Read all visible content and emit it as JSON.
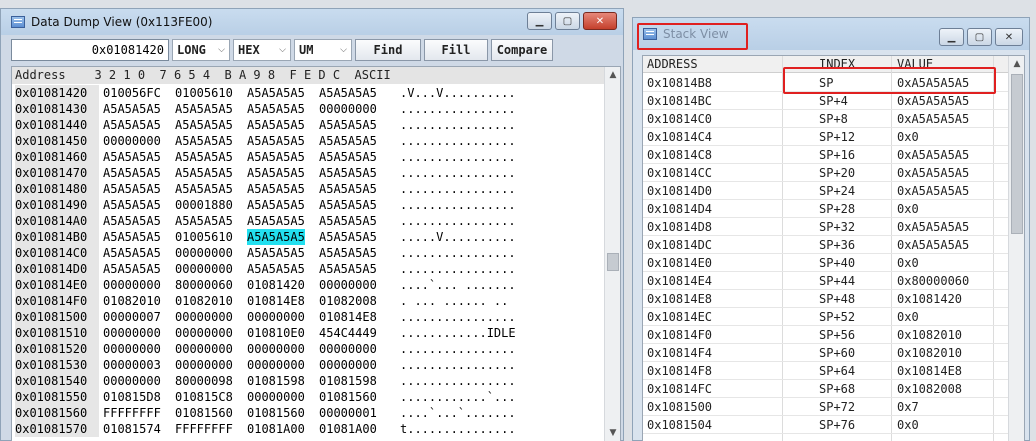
{
  "dump_window": {
    "title": "Data Dump View (0x113FE00)",
    "address_input": "0x01081420",
    "selects": [
      "LONG",
      "HEX",
      "UM"
    ],
    "buttons": [
      "Find",
      "Fill",
      "Compare"
    ],
    "header": "Address    3 2 1 0  7 6 5 4  B A 9 8  F E D C  ASCII",
    "highlight": {
      "row": 9,
      "col": 2
    },
    "rows": [
      {
        "addr": "0x01081420",
        "w": [
          "010056FC",
          "01005610",
          "A5A5A5A5",
          "A5A5A5A5"
        ],
        "ascii": ".V...V.........."
      },
      {
        "addr": "0x01081430",
        "w": [
          "A5A5A5A5",
          "A5A5A5A5",
          "A5A5A5A5",
          "00000000"
        ],
        "ascii": "................"
      },
      {
        "addr": "0x01081440",
        "w": [
          "A5A5A5A5",
          "A5A5A5A5",
          "A5A5A5A5",
          "A5A5A5A5"
        ],
        "ascii": "................"
      },
      {
        "addr": "0x01081450",
        "w": [
          "00000000",
          "A5A5A5A5",
          "A5A5A5A5",
          "A5A5A5A5"
        ],
        "ascii": "................"
      },
      {
        "addr": "0x01081460",
        "w": [
          "A5A5A5A5",
          "A5A5A5A5",
          "A5A5A5A5",
          "A5A5A5A5"
        ],
        "ascii": "................"
      },
      {
        "addr": "0x01081470",
        "w": [
          "A5A5A5A5",
          "A5A5A5A5",
          "A5A5A5A5",
          "A5A5A5A5"
        ],
        "ascii": "................"
      },
      {
        "addr": "0x01081480",
        "w": [
          "A5A5A5A5",
          "A5A5A5A5",
          "A5A5A5A5",
          "A5A5A5A5"
        ],
        "ascii": "................"
      },
      {
        "addr": "0x01081490",
        "w": [
          "A5A5A5A5",
          "00001880",
          "A5A5A5A5",
          "A5A5A5A5"
        ],
        "ascii": "................"
      },
      {
        "addr": "0x010814A0",
        "w": [
          "A5A5A5A5",
          "A5A5A5A5",
          "A5A5A5A5",
          "A5A5A5A5"
        ],
        "ascii": "................"
      },
      {
        "addr": "0x010814B0",
        "w": [
          "A5A5A5A5",
          "01005610",
          "A5A5A5A5",
          "A5A5A5A5"
        ],
        "ascii": ".....V.........."
      },
      {
        "addr": "0x010814C0",
        "w": [
          "A5A5A5A5",
          "00000000",
          "A5A5A5A5",
          "A5A5A5A5"
        ],
        "ascii": "................"
      },
      {
        "addr": "0x010814D0",
        "w": [
          "A5A5A5A5",
          "00000000",
          "A5A5A5A5",
          "A5A5A5A5"
        ],
        "ascii": "................"
      },
      {
        "addr": "0x010814E0",
        "w": [
          "00000000",
          "80000060",
          "01081420",
          "00000000"
        ],
        "ascii": "....`... ......."
      },
      {
        "addr": "0x010814F0",
        "w": [
          "01082010",
          "01082010",
          "010814E8",
          "01082008"
        ],
        "ascii": ". ... ...... .."
      },
      {
        "addr": "0x01081500",
        "w": [
          "00000007",
          "00000000",
          "00000000",
          "010814E8"
        ],
        "ascii": "................"
      },
      {
        "addr": "0x01081510",
        "w": [
          "00000000",
          "00000000",
          "010810E0",
          "454C4449"
        ],
        "ascii": "............IDLE"
      },
      {
        "addr": "0x01081520",
        "w": [
          "00000000",
          "00000000",
          "00000000",
          "00000000"
        ],
        "ascii": "................"
      },
      {
        "addr": "0x01081530",
        "w": [
          "00000003",
          "00000000",
          "00000000",
          "00000000"
        ],
        "ascii": "................"
      },
      {
        "addr": "0x01081540",
        "w": [
          "00000000",
          "80000098",
          "01081598",
          "01081598"
        ],
        "ascii": "................"
      },
      {
        "addr": "0x01081550",
        "w": [
          "010815D8",
          "010815C8",
          "00000000",
          "01081560"
        ],
        "ascii": "............`..."
      },
      {
        "addr": "0x01081560",
        "w": [
          "FFFFFFFF",
          "01081560",
          "01081560",
          "00000001"
        ],
        "ascii": "....`...`......."
      },
      {
        "addr": "0x01081570",
        "w": [
          "01081574",
          "FFFFFFFF",
          "01081A00",
          "01081A00"
        ],
        "ascii": "t..............."
      }
    ]
  },
  "stack_window": {
    "title": "Stack View",
    "columns": [
      "ADDRESS",
      "INDEX",
      "VALUE"
    ],
    "highlight_row": 0,
    "rows": [
      {
        "address": "0x10814B8",
        "index": "SP",
        "value": "0xA5A5A5A5"
      },
      {
        "address": "0x10814BC",
        "index": "SP+4",
        "value": "0xA5A5A5A5"
      },
      {
        "address": "0x10814C0",
        "index": "SP+8",
        "value": "0xA5A5A5A5"
      },
      {
        "address": "0x10814C4",
        "index": "SP+12",
        "value": "0x0"
      },
      {
        "address": "0x10814C8",
        "index": "SP+16",
        "value": "0xA5A5A5A5"
      },
      {
        "address": "0x10814CC",
        "index": "SP+20",
        "value": "0xA5A5A5A5"
      },
      {
        "address": "0x10814D0",
        "index": "SP+24",
        "value": "0xA5A5A5A5"
      },
      {
        "address": "0x10814D4",
        "index": "SP+28",
        "value": "0x0"
      },
      {
        "address": "0x10814D8",
        "index": "SP+32",
        "value": "0xA5A5A5A5"
      },
      {
        "address": "0x10814DC",
        "index": "SP+36",
        "value": "0xA5A5A5A5"
      },
      {
        "address": "0x10814E0",
        "index": "SP+40",
        "value": "0x0"
      },
      {
        "address": "0x10814E4",
        "index": "SP+44",
        "value": "0x80000060"
      },
      {
        "address": "0x10814E8",
        "index": "SP+48",
        "value": "0x1081420"
      },
      {
        "address": "0x10814EC",
        "index": "SP+52",
        "value": "0x0"
      },
      {
        "address": "0x10814F0",
        "index": "SP+56",
        "value": "0x1082010"
      },
      {
        "address": "0x10814F4",
        "index": "SP+60",
        "value": "0x1082010"
      },
      {
        "address": "0x10814F8",
        "index": "SP+64",
        "value": "0x10814E8"
      },
      {
        "address": "0x10814FC",
        "index": "SP+68",
        "value": "0x1082008"
      },
      {
        "address": "0x1081500",
        "index": "SP+72",
        "value": "0x7"
      },
      {
        "address": "0x1081504",
        "index": "SP+76",
        "value": "0x0"
      }
    ]
  },
  "colors": {
    "highlight": "#22e0f0",
    "annotation": "#e02020",
    "titlebar": "#c9dcef"
  },
  "icons": {
    "minimize": "minimize-icon",
    "maximize": "maximize-icon",
    "close": "close-icon",
    "window": "window-icon"
  }
}
